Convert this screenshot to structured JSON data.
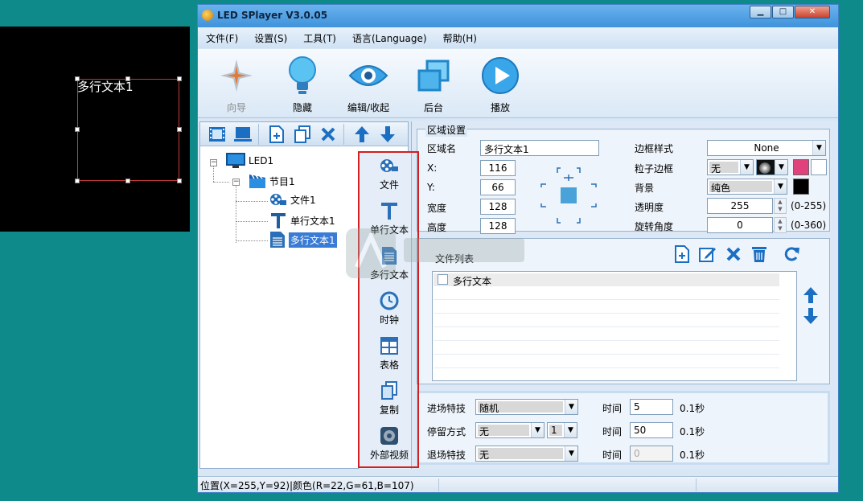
{
  "preview": {
    "zone_text": "多行文本1"
  },
  "window": {
    "title": "LED SPlayer V3.0.05",
    "buttons": [
      "▁",
      "□",
      "✕"
    ]
  },
  "menu": [
    "文件(F)",
    "设置(S)",
    "工具(T)",
    "语言(Language)",
    "帮助(H)"
  ],
  "toolbar": [
    {
      "label": "向导",
      "icon": "wizard-icon",
      "disabled": true
    },
    {
      "label": "隐藏",
      "icon": "lightbulb-icon"
    },
    {
      "label": "编辑/收起",
      "icon": "eye-icon"
    },
    {
      "label": "后台",
      "icon": "windows-stack-icon"
    },
    {
      "label": "播放",
      "icon": "play-icon"
    }
  ],
  "tree": {
    "led": "LED1",
    "program": "节目1",
    "file": "文件1",
    "single_text": "单行文本1",
    "multi_text": "多行文本1"
  },
  "strip": [
    "文件",
    "单行文本",
    "多行文本",
    "时钟",
    "表格",
    "复制",
    "外部视频"
  ],
  "area": {
    "title": "区域设置",
    "name_label": "区域名",
    "name_value": "多行文本1",
    "x_label": "X:",
    "x_value": "116",
    "y_label": "Y:",
    "y_value": "66",
    "w_label": "宽度",
    "w_value": "128",
    "h_label": "高度",
    "h_value": "128",
    "border_style_label": "边框样式",
    "border_style_value": "None",
    "particle_label": "粒子边框",
    "particle_value": "无",
    "bg_label": "背景",
    "bg_value": "纯色",
    "opacity_label": "透明度",
    "opacity_value": "255",
    "opacity_range": "(0-255)",
    "rotate_label": "旋转角度",
    "rotate_value": "0",
    "rotate_range": "(0-360)"
  },
  "filelist": {
    "title": "文件列表",
    "items": [
      "多行文本"
    ]
  },
  "effects": {
    "enter_label": "进场特技",
    "enter_value": "随机",
    "stay_label": "停留方式",
    "stay_value": "无",
    "stay_count": "1",
    "exit_label": "退场特技",
    "exit_value": "无",
    "time_label": "时间",
    "enter_time": "5",
    "stay_time": "50",
    "exit_time": "0",
    "unit": "0.1秒"
  },
  "status": {
    "position": "位置(X=255,Y=92)|颜色(R=22,G=61,B=107)"
  },
  "colors": {
    "accent": "#3a7bd5",
    "highlight_box": "#d21f1f",
    "border_color_swatch": "#e0437c"
  }
}
